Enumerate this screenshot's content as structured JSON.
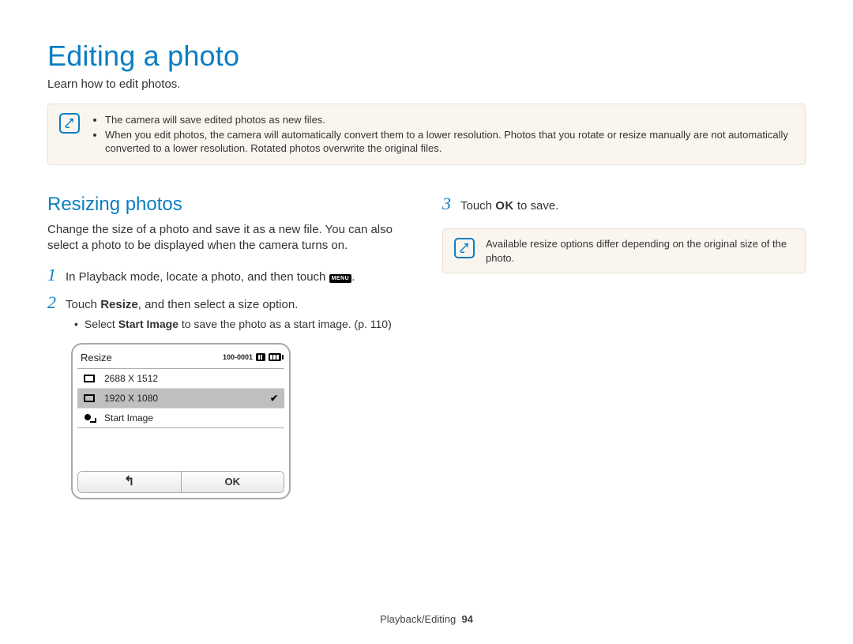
{
  "page_title": "Editing a photo",
  "subtitle": "Learn how to edit photos.",
  "top_note": {
    "items": [
      "The camera will save edited photos as new files.",
      "When you edit photos, the camera will automatically convert them to a lower resolution. Photos that you rotate or resize manually are not automatically converted to a lower resolution. Rotated photos overwrite the original files."
    ]
  },
  "section": {
    "heading": "Resizing photos",
    "lead": "Change the size of a photo and save it as a new file. You can also select a photo to be displayed when the camera turns on."
  },
  "steps": {
    "one": {
      "num": "1",
      "text_before": "In Playback mode, locate a photo, and then touch ",
      "menu_label": "MENU",
      "text_after": "."
    },
    "two": {
      "num": "2",
      "text_before": "Touch ",
      "bold": "Resize",
      "text_after": ", and then select a size option.",
      "sub_prefix": "Select ",
      "sub_bold": "Start Image",
      "sub_suffix": " to save the photo as a start image. (p. 110)"
    },
    "three": {
      "num": "3",
      "text_before": "Touch ",
      "ok_label": "OK",
      "text_after": " to save."
    }
  },
  "side_note": "Available resize options differ depending on the original size of the photo.",
  "camera": {
    "title": "Resize",
    "file_label": "100-0001",
    "rows": [
      {
        "label": "2688 X 1512",
        "selected": false
      },
      {
        "label": "1920 X 1080",
        "selected": true
      },
      {
        "label": "Start Image",
        "selected": false
      }
    ],
    "back_symbol": "↰",
    "ok_label": "OK"
  },
  "footer": {
    "section": "Playback/Editing",
    "page": "94"
  }
}
